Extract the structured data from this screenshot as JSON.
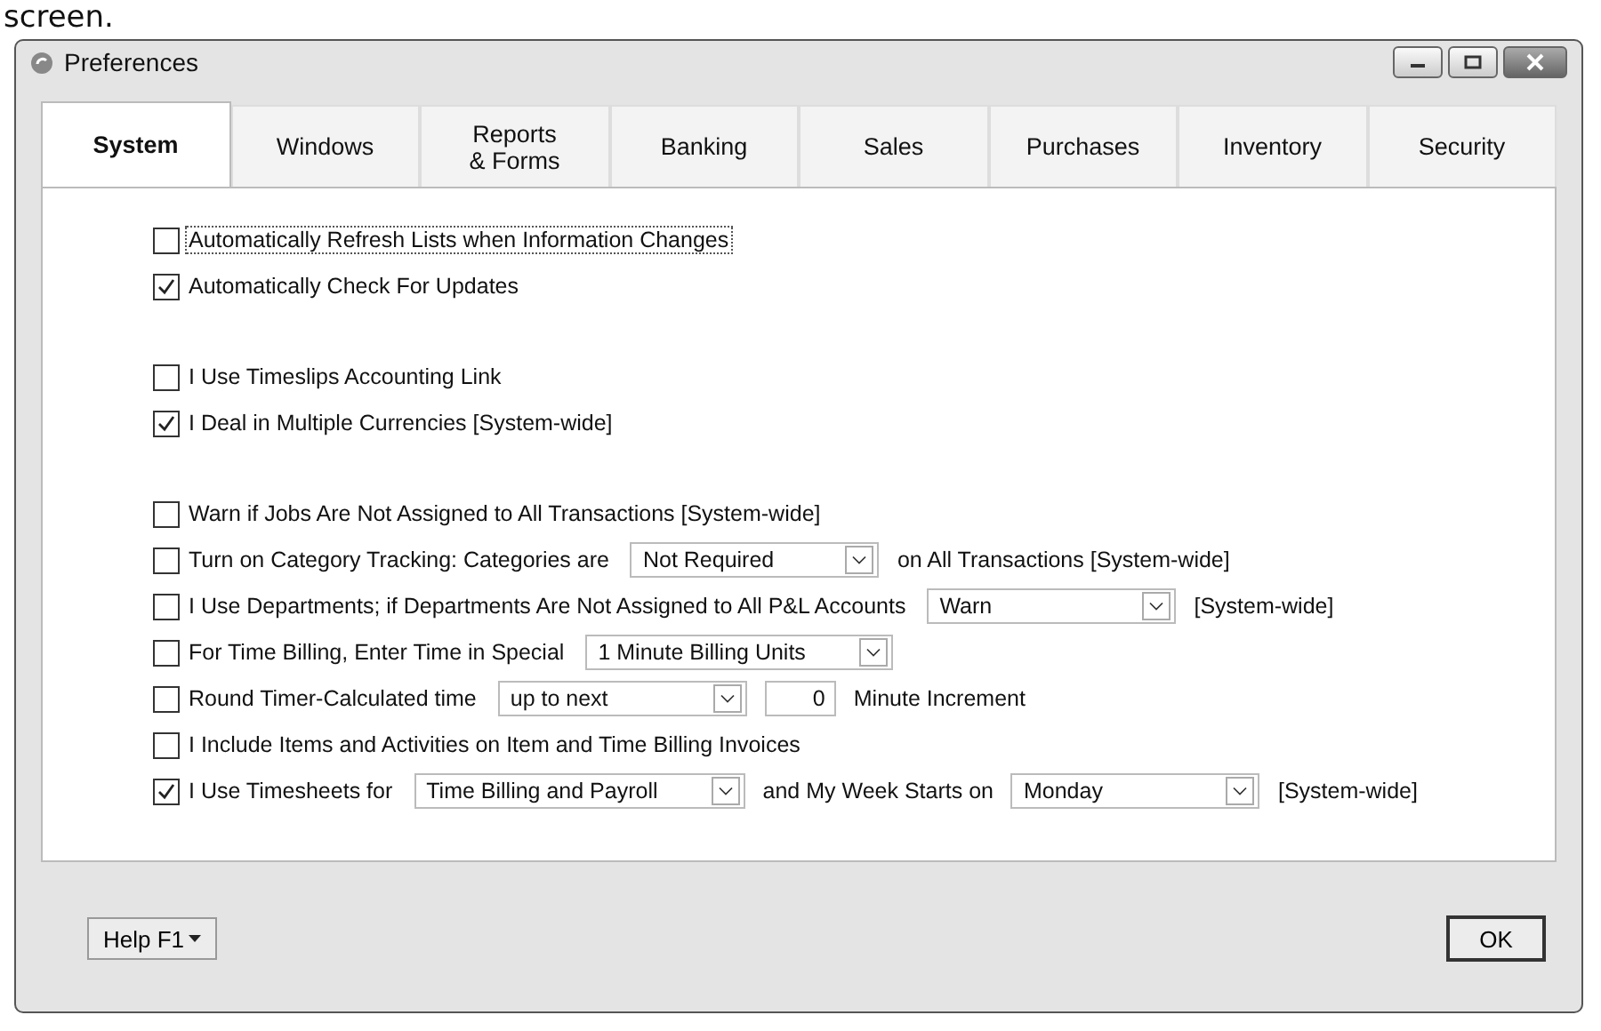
{
  "page_text": "screen.",
  "window": {
    "title": "Preferences"
  },
  "tabs": [
    {
      "label": "System",
      "selected": true
    },
    {
      "label": "Windows",
      "selected": false
    },
    {
      "label": "Reports\n& Forms",
      "selected": false
    },
    {
      "label": "Banking",
      "selected": false
    },
    {
      "label": "Sales",
      "selected": false
    },
    {
      "label": "Purchases",
      "selected": false
    },
    {
      "label": "Inventory",
      "selected": false
    },
    {
      "label": "Security",
      "selected": false
    }
  ],
  "groups": [
    [
      [
        {
          "kind": "check",
          "label": "Automatically Refresh Lists when Information Changes",
          "checked": false,
          "focused": true
        }
      ],
      [
        {
          "kind": "check",
          "label": "Automatically Check For Updates",
          "checked": true
        }
      ]
    ],
    [
      [
        {
          "kind": "check",
          "label": "I Use Timeslips Accounting Link",
          "checked": false
        }
      ],
      [
        {
          "kind": "check",
          "label": "I Deal in Multiple Currencies [System-wide]",
          "checked": true
        }
      ]
    ],
    [
      [
        {
          "kind": "check",
          "label": "Warn if Jobs Are Not Assigned to All Transactions [System-wide]",
          "checked": false
        }
      ],
      [
        {
          "kind": "check",
          "label": "Turn on Category Tracking:  Categories are",
          "checked": false
        },
        {
          "kind": "select",
          "value": "Not Required"
        },
        {
          "kind": "text",
          "text": "on All Transactions [System-wide]"
        }
      ],
      [
        {
          "kind": "check",
          "label": "I Use Departments; if Departments Are Not Assigned to All P&L Accounts",
          "checked": false
        },
        {
          "kind": "select",
          "value": "Warn"
        },
        {
          "kind": "text",
          "text": "[System-wide]"
        }
      ],
      [
        {
          "kind": "check",
          "label": "For Time Billing, Enter Time in Special",
          "checked": false
        },
        {
          "kind": "select",
          "value": "1 Minute Billing Units"
        }
      ],
      [
        {
          "kind": "check",
          "label": "Round Timer-Calculated time",
          "checked": false
        },
        {
          "kind": "select",
          "value": "up to next"
        },
        {
          "kind": "number",
          "value": "0"
        },
        {
          "kind": "text",
          "text": "Minute Increment"
        }
      ],
      [
        {
          "kind": "check",
          "label": "I Include Items and Activities on Item and Time Billing Invoices",
          "checked": false
        }
      ],
      [
        {
          "kind": "check",
          "label": "I Use Timesheets for",
          "checked": true
        },
        {
          "kind": "select",
          "value": "Time Billing and Payroll"
        },
        {
          "kind": "text",
          "text": "and My Week Starts on"
        },
        {
          "kind": "select",
          "value": "Monday"
        },
        {
          "kind": "text",
          "text": "[System-wide]"
        }
      ]
    ]
  ],
  "buttons": {
    "help": "Help F1",
    "ok": "OK"
  }
}
